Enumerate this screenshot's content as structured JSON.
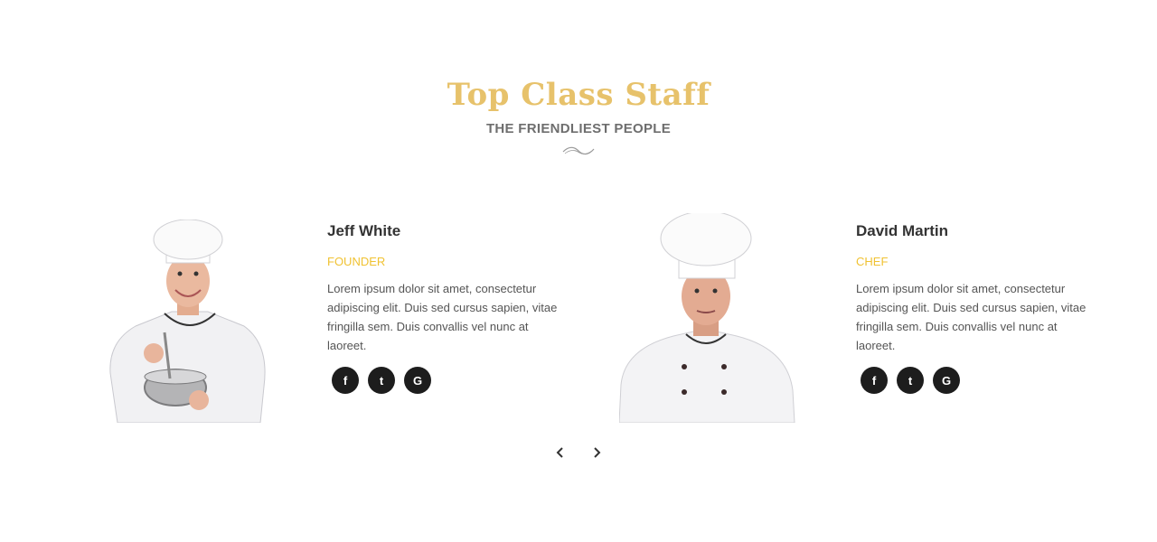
{
  "section": {
    "title": "Top Class Staff",
    "subtitle": "THE FRIENDLIEST PEOPLE"
  },
  "staff": [
    {
      "name": "Jeff White",
      "role": "FOUNDER",
      "bio": "Lorem ipsum dolor sit amet, consectetur adipiscing elit. Duis sed cursus sapien, vitae fringilla sem. Duis convallis vel nunc at laoreet.",
      "socials": [
        "f",
        "t",
        "G"
      ]
    },
    {
      "name": "David Martin",
      "role": "CHEF",
      "bio": "Lorem ipsum dolor sit amet, consectetur adipiscing elit. Duis sed cursus sapien, vitae fringilla sem. Duis convallis vel nunc at laoreet.",
      "socials": [
        "f",
        "t",
        "G"
      ]
    }
  ],
  "colors": {
    "title": "#e7c26b",
    "role": "#f0c232",
    "icon_bg": "#1d1d1d"
  },
  "icons": {
    "social": [
      "facebook-icon",
      "twitter-icon",
      "google-icon"
    ],
    "nav": [
      "chevron-left-icon",
      "chevron-right-icon"
    ]
  }
}
